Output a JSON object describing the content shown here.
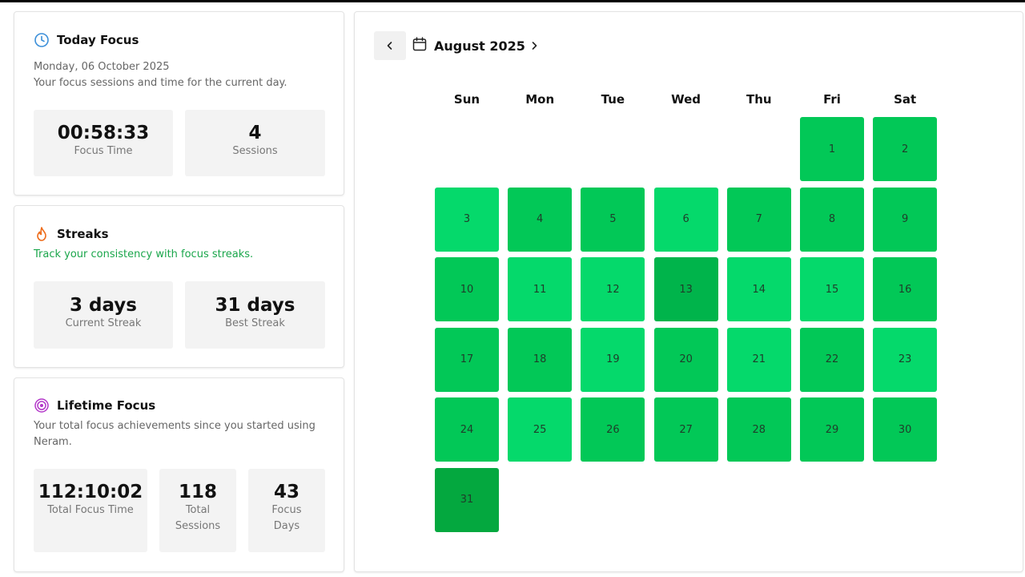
{
  "today": {
    "title": "Today Focus",
    "date": "Monday, 06 October 2025",
    "description": "Your focus sessions and time for the current day.",
    "focus_time": "00:58:33",
    "focus_time_label": "Focus Time",
    "sessions": "4",
    "sessions_label": "Sessions"
  },
  "streaks": {
    "title": "Streaks",
    "description": "Track your consistency with focus streaks.",
    "current": "3 days",
    "current_label": "Current Streak",
    "best": "31 days",
    "best_label": "Best Streak"
  },
  "lifetime": {
    "title": "Lifetime Focus",
    "description": "Your total focus achievements since you started using Neram.",
    "total_time": "112:10:02",
    "total_time_label": "Total Focus Time",
    "sessions": "118",
    "sessions_label": "Total Sessions",
    "days": "43",
    "days_label": "Focus Days"
  },
  "calendar": {
    "month_label": "August 2025",
    "weekdays": [
      "Sun",
      "Mon",
      "Tue",
      "Wed",
      "Thu",
      "Fri",
      "Sat"
    ],
    "first_weekday_index": 5,
    "days": [
      {
        "day": "1",
        "level": 2
      },
      {
        "day": "2",
        "level": 2
      },
      {
        "day": "3",
        "level": 1
      },
      {
        "day": "4",
        "level": 2
      },
      {
        "day": "5",
        "level": 2
      },
      {
        "day": "6",
        "level": 1
      },
      {
        "day": "7",
        "level": 2
      },
      {
        "day": "8",
        "level": 2
      },
      {
        "day": "9",
        "level": 2
      },
      {
        "day": "10",
        "level": 2
      },
      {
        "day": "11",
        "level": 1
      },
      {
        "day": "12",
        "level": 1
      },
      {
        "day": "13",
        "level": 3
      },
      {
        "day": "14",
        "level": 1
      },
      {
        "day": "15",
        "level": 1
      },
      {
        "day": "16",
        "level": 2
      },
      {
        "day": "17",
        "level": 2
      },
      {
        "day": "18",
        "level": 2
      },
      {
        "day": "19",
        "level": 1
      },
      {
        "day": "20",
        "level": 2
      },
      {
        "day": "21",
        "level": 1
      },
      {
        "day": "22",
        "level": 2
      },
      {
        "day": "23",
        "level": 1
      },
      {
        "day": "24",
        "level": 2
      },
      {
        "day": "25",
        "level": 1
      },
      {
        "day": "26",
        "level": 2
      },
      {
        "day": "27",
        "level": 2
      },
      {
        "day": "28",
        "level": 2
      },
      {
        "day": "29",
        "level": 2
      },
      {
        "day": "30",
        "level": 2
      },
      {
        "day": "31",
        "level": 4
      }
    ]
  },
  "colors": {
    "level1": "#05d96b",
    "level2": "#02c857",
    "level3": "#00b44b",
    "level4": "#04a83f",
    "streak_subtitle": "#1aa64b"
  },
  "icons": {
    "today": "clock-icon",
    "streaks": "flame-icon",
    "lifetime": "target-icon",
    "prev": "chevron-left-icon",
    "next": "chevron-right-icon",
    "calendar": "calendar-icon"
  }
}
